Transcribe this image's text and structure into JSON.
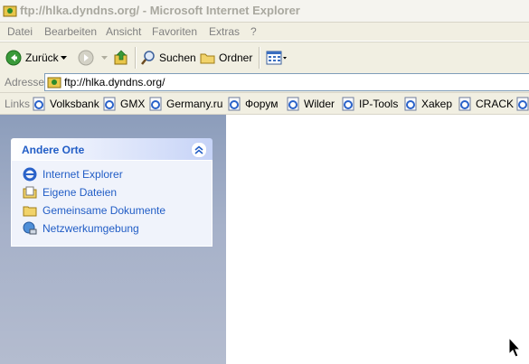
{
  "window": {
    "title": "ftp://hlka.dyndns.org/ - Microsoft Internet Explorer"
  },
  "menu": [
    {
      "id": "datei",
      "label": "Datei"
    },
    {
      "id": "bearbeiten",
      "label": "Bearbeiten"
    },
    {
      "id": "ansicht",
      "label": "Ansicht"
    },
    {
      "id": "favoriten",
      "label": "Favoriten"
    },
    {
      "id": "extras",
      "label": "Extras"
    },
    {
      "id": "help",
      "label": "?"
    }
  ],
  "toolbar": {
    "back_label": "Zurück",
    "search_label": "Suchen",
    "folders_label": "Ordner"
  },
  "address": {
    "label": "Adresse",
    "url": "ftp://hlka.dyndns.org/"
  },
  "links": {
    "label": "Links",
    "items": [
      "Volksbank",
      "GMX",
      "Germany.ru",
      "Форум",
      "Wilder",
      "IP-Tools",
      "Xakep",
      "CRACK"
    ]
  },
  "other_places": {
    "title": "Andere Orte",
    "items": [
      "Internet Explorer",
      "Eigene Dateien",
      "Gemeinsame Dokumente",
      "Netzwerkumgebung"
    ]
  },
  "colors": {
    "panel_text": "#215dc6",
    "pane_bg": "#a6b1c9",
    "accent_green": "#3a9a3a"
  }
}
